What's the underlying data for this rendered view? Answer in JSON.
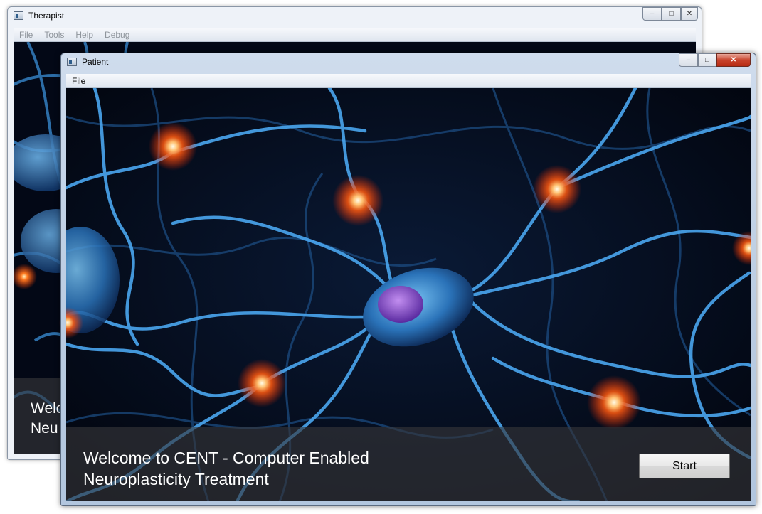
{
  "therapist": {
    "title": "Therapist",
    "menu": [
      "File",
      "Tools",
      "Help",
      "Debug"
    ],
    "welcome_partial": "Welco\nNeu"
  },
  "patient": {
    "title": "Patient",
    "menu": [
      "File"
    ],
    "welcome": "Welcome to CENT - Computer Enabled\nNeuroplasticity Treatment",
    "start_label": "Start"
  },
  "controls": {
    "minimize": "–",
    "maximize": "□",
    "close": "✕"
  },
  "background_image": "neuron-network-illustration",
  "colors": {
    "neuron_blue": "#3a8fd8",
    "glow": "#ff6a1a",
    "overlay": "#37373a"
  }
}
